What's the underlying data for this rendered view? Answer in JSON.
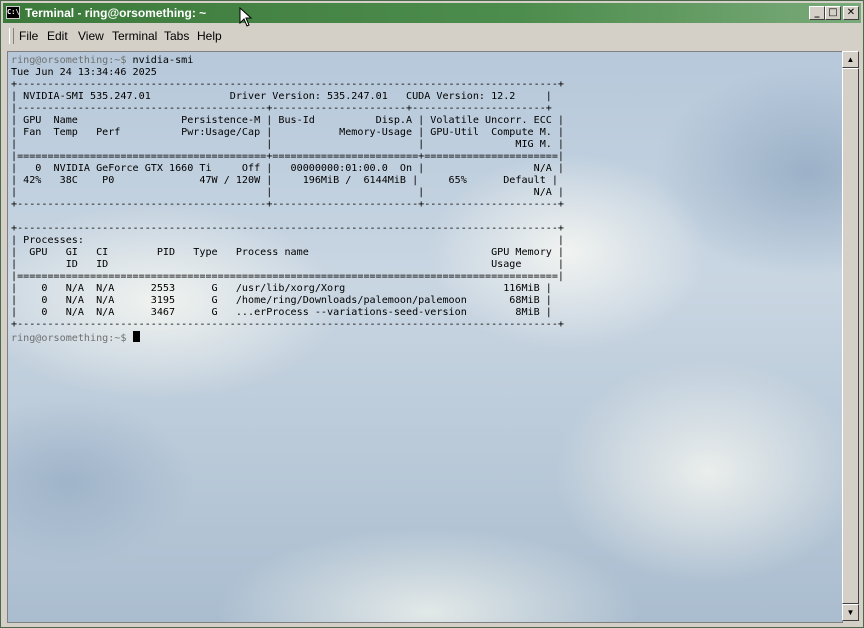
{
  "window": {
    "title": "Terminal - ring@orsomething: ~",
    "icon": "terminal-icon",
    "controls": [
      "minimize-icon",
      "maximize-icon",
      "close-icon"
    ]
  },
  "menubar": {
    "items": [
      "File",
      "Edit",
      "View",
      "Terminal",
      "Tabs",
      "Help"
    ]
  },
  "terminal": {
    "prompt": "ring@orsomething:~$",
    "command": " nvidia-smi",
    "timestamp": "Tue Jun 24 13:34:46 2025",
    "output": "+-----------------------------------------------------------------------------+\n| NVIDIA-SMI 535.247.01             Driver Version: 535.247.01   CUDA Version: 12.2     |\n|-------------------------------+----------------------+----------------------+\n| GPU  Name        Persistence-M | Bus-Id        Disp.A | Volatile Uncorr. ECC |\n| Fan  Temp   Perf  Pwr:Usage/Cap |         Memory-Usage | GPU-Util  Compute M. |\n|                                 |                      |               MIG M. |\n|===============================+======================+======================|\n|   0  NVIDIA GeForce GTX 1660 Ti     Off | 00000000:01:00.0  On |                  N/A |\n| 42%   38C    P0             47W /  120W |    196MiB /  6144MiB |     65%      Default |\n|                                         |                      |                  N/A |\n+-------------------------------+----------------------+----------------------+\n\n+-----------------------------------------------------------------------------+\n| Processes:                                                                  |\n|  GPU   GI   CI        PID   Type   Process name                   GPU Memory |\n|        ID   ID                                                       Usage  |\n|=============================================================================|\n|    0   N/A  N/A      2553      G   /usr/lib/xorg/Xorg                 116MiB |\n|    0   N/A  N/A      3195      G   /home/ring/Downloads/palemoon/palemoon     68MiB |\n|    0   N/A  N/A      3467      G   ...erProcess --variations-seed-version      8MiB |\n+-----------------------------------------------------------------------------+",
    "output_lines": [
      "+-----------------------------------------------------------------------------------------+",
      "| NVIDIA-SMI 535.247.01             Driver Version: 535.247.01   CUDA Version: 12.2     |",
      "|-----------------------------------------+----------------------+----------------------+",
      "| GPU  Name                 Persistence-M | Bus-Id          Disp.A | Volatile Uncorr. ECC |",
      "| Fan  Temp   Perf          Pwr:Usage/Cap |           Memory-Usage | GPU-Util  Compute M. |",
      "|                                         |                        |               MIG M. |",
      "|=========================================+========================+======================|",
      "|   0  NVIDIA GeForce GTX 1660 Ti     Off |   00000000:01:00.0  On |                  N/A |",
      "| 42%   38C    P0              47W / 120W |     196MiB /  6144MiB |     65%      Default |",
      "|                                         |                        |                  N/A |",
      "+-----------------------------------------+------------------------+----------------------+",
      "",
      "+-----------------------------------------------------------------------------------------+",
      "| Processes:                                                                              |",
      "|  GPU   GI   CI        PID   Type   Process name                              GPU Memory |",
      "|        ID   ID                                                               Usage      |",
      "|=========================================================================================|",
      "|    0   N/A  N/A      2553      G   /usr/lib/xorg/Xorg                          116MiB |",
      "|    0   N/A  N/A      3195      G   /home/ring/Downloads/palemoon/palemoon       68MiB |",
      "|    0   N/A  N/A      3467      G   ...erProcess --variations-seed-version        8MiB |",
      "+-----------------------------------------------------------------------------------------+"
    ],
    "final_prompt": "ring@orsomething:~$"
  },
  "colors": {
    "titlebar": "#3c7a3c",
    "prompt": "#707070",
    "text": "#000000"
  }
}
